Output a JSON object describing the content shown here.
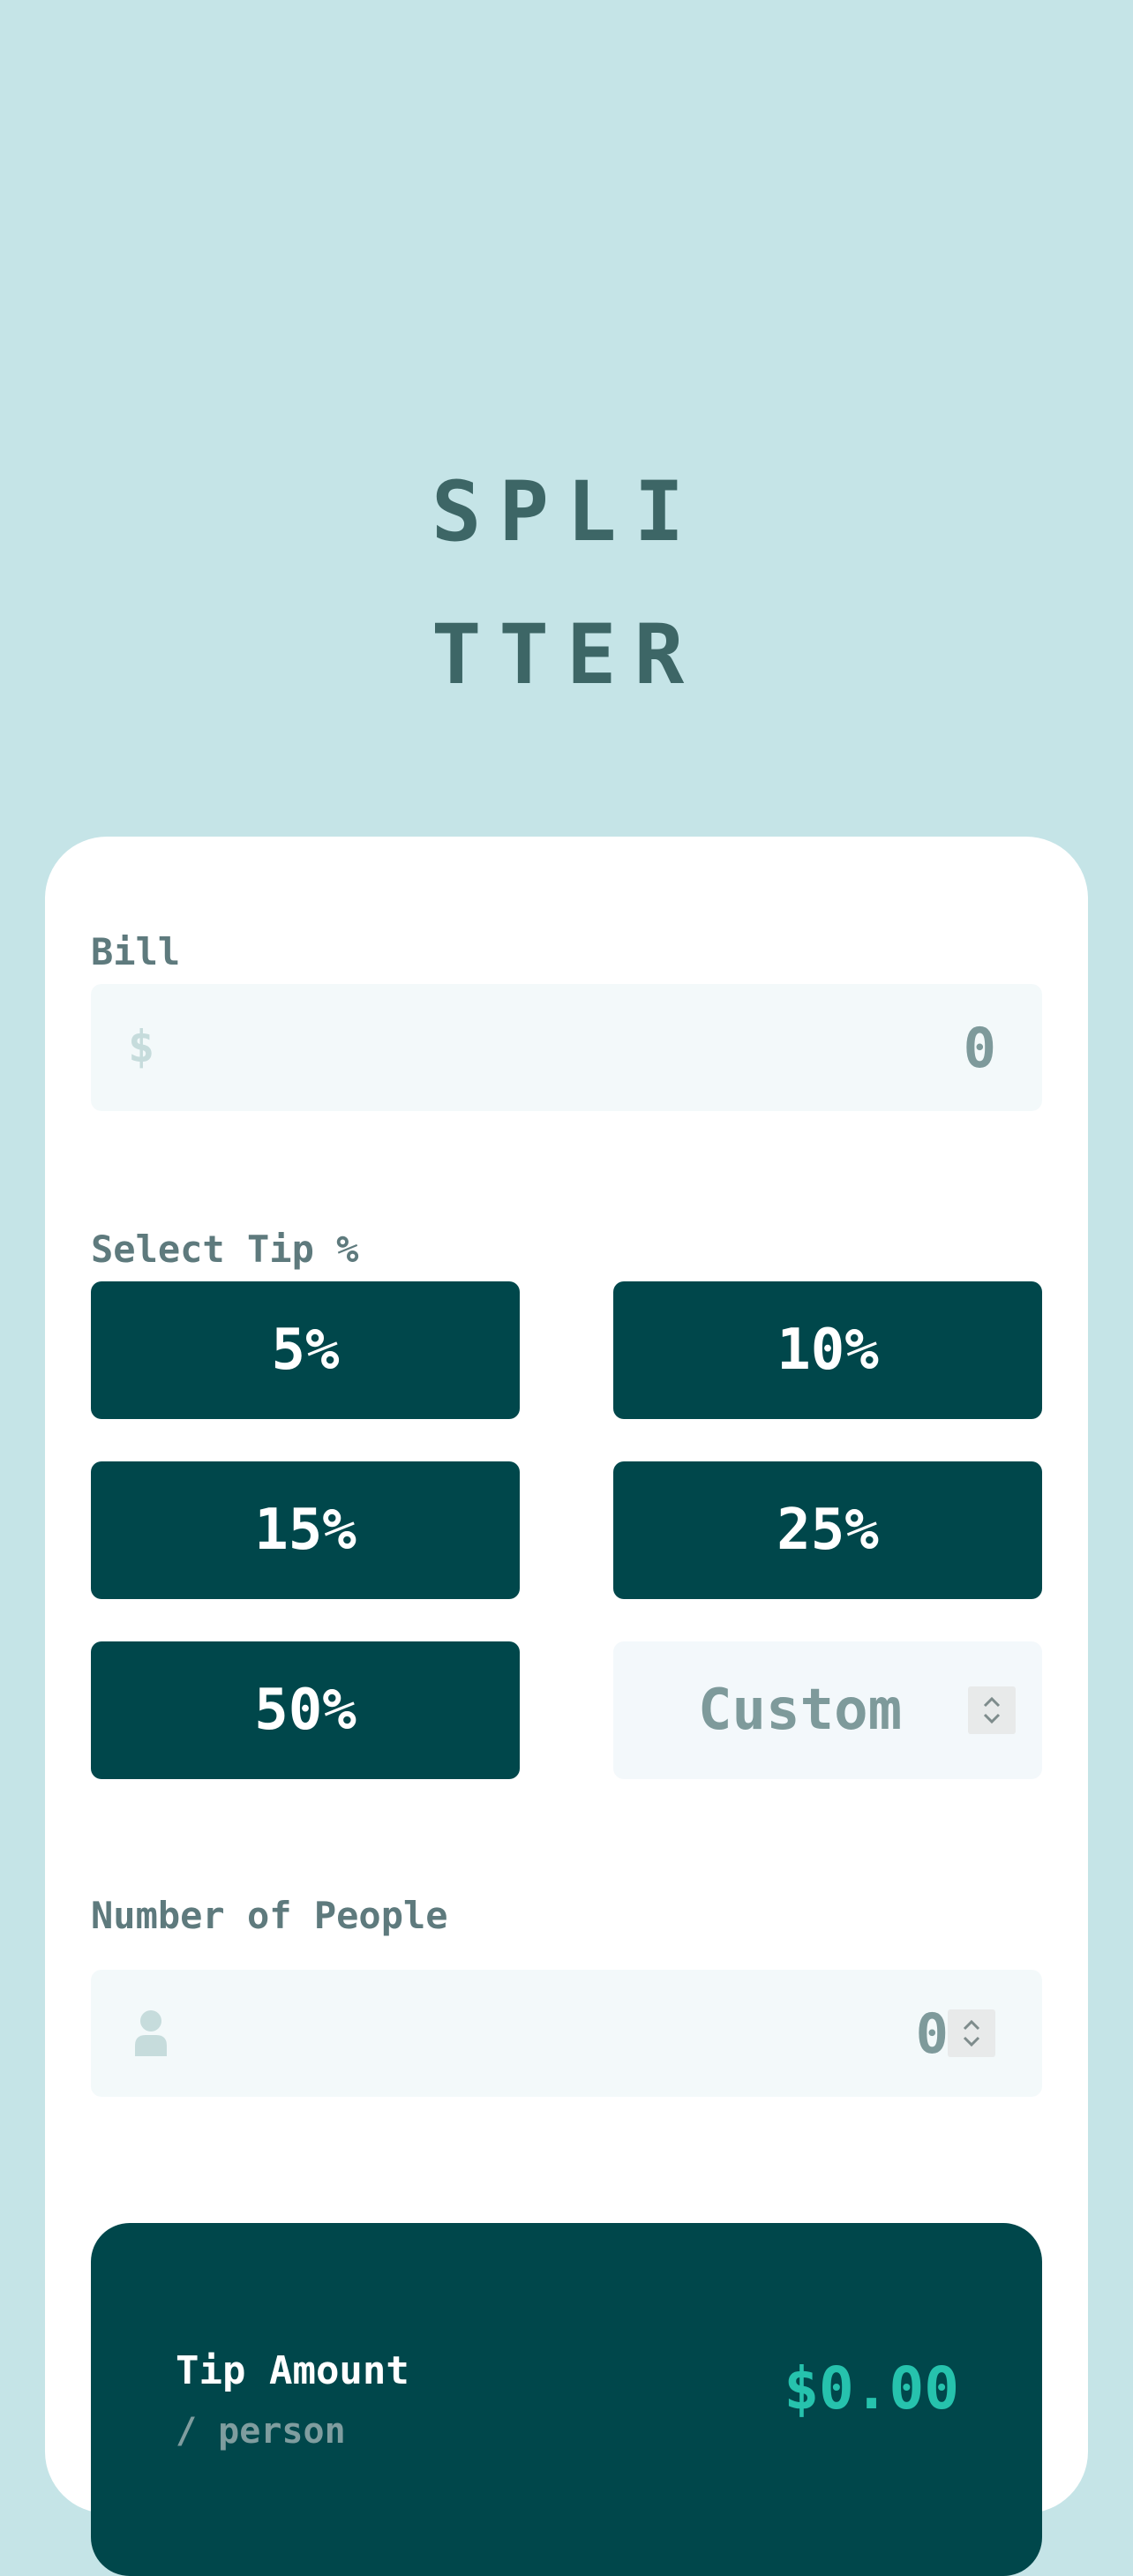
{
  "app": {
    "title_line1": "SPLI",
    "title_line2": "TTER"
  },
  "bill": {
    "label": "Bill",
    "icon": "dollar-icon",
    "currency_symbol": "$",
    "value": "0"
  },
  "tip": {
    "label": "Select Tip %",
    "options": [
      "5%",
      "10%",
      "15%",
      "25%",
      "50%"
    ],
    "custom_placeholder": "Custom"
  },
  "people": {
    "label": "Number of People",
    "icon": "person-icon",
    "value": "0"
  },
  "result": {
    "tip_amount_label": "Tip Amount",
    "per_person_label": "/ person",
    "tip_amount_value": "$0.00"
  },
  "colors": {
    "background": "#c5e4e7",
    "card": "#ffffff",
    "accent_dark": "#00474b",
    "accent_strong": "#26c2ad",
    "title": "#3d6666"
  }
}
